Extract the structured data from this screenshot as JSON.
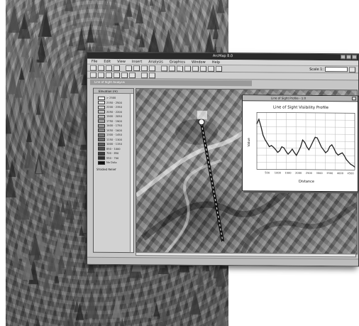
{
  "window": {
    "title": "ArcMap 8.0",
    "menu": [
      "File",
      "Edit",
      "View",
      "Insert",
      "Analysis",
      "Graphics",
      "Window",
      "Help"
    ],
    "scale_label": "Scale 1:",
    "document_title": "Line of Sight Analysis"
  },
  "legend": {
    "title": "Elevation (m)",
    "items": [
      {
        "label": "> 2500",
        "color": "#f4f4f4"
      },
      {
        "label": "2350 - 2500",
        "color": "#e6e6e6"
      },
      {
        "label": "2200 - 2350",
        "color": "#d6d6d6"
      },
      {
        "label": "2050 - 2200",
        "color": "#c6c6c6"
      },
      {
        "label": "1900 - 2050",
        "color": "#b8b8b8"
      },
      {
        "label": "1750 - 1900",
        "color": "#a8a8a8"
      },
      {
        "label": "1600 - 1750",
        "color": "#9a9a9a"
      },
      {
        "label": "1450 - 1600",
        "color": "#8a8a8a"
      },
      {
        "label": "1300 - 1450",
        "color": "#7c7c7c"
      },
      {
        "label": "1150 - 1300",
        "color": "#6c6c6c"
      },
      {
        "label": "1000 - 1150",
        "color": "#5e5e5e"
      },
      {
        "label": "850 - 1000",
        "color": "#4e4e4e"
      },
      {
        "label": "700 - 850",
        "color": "#404040"
      },
      {
        "label": "550 - 700",
        "color": "#303030"
      },
      {
        "label": "No Data",
        "color": "#101010"
      }
    ],
    "sub_layer": "Shaded Relief"
  },
  "profile": {
    "window_title": "Line of Sight Profile - 1:0",
    "x_tick_labels": [
      "500",
      "1000",
      "1500",
      "2000",
      "2500",
      "3000",
      "3500",
      "4000",
      "4500"
    ]
  },
  "chart_data": {
    "type": "line",
    "title": "Line of Sight Visibility Profile",
    "xlabel": "Distance",
    "ylabel": "Value",
    "x": [
      0,
      100,
      200,
      300,
      400,
      500,
      600,
      700,
      800,
      900,
      1000,
      1100,
      1200,
      1300,
      1400,
      1500,
      1600,
      1700,
      1800,
      1900,
      2000,
      2100,
      2200,
      2300,
      2400,
      2500,
      2600,
      2700,
      2800,
      2900,
      3000,
      3100,
      3200,
      3300,
      3400,
      3500,
      3600,
      3700,
      3800,
      3900,
      4000,
      4100,
      4200,
      4300,
      4400,
      4500,
      4600,
      4700
    ],
    "series": [
      {
        "values": [
          2100,
          2180,
          2050,
          1900,
          1820,
          1760,
          1700,
          1720,
          1690,
          1650,
          1600,
          1630,
          1700,
          1680,
          1620,
          1570,
          1610,
          1660,
          1600,
          1550,
          1620,
          1700,
          1820,
          1780,
          1700,
          1650,
          1720,
          1800,
          1870,
          1860,
          1780,
          1700,
          1650,
          1600,
          1630,
          1710,
          1740,
          1680,
          1600,
          1560,
          1580,
          1600,
          1550,
          1480,
          1440,
          1400,
          1380,
          1350
        ]
      }
    ],
    "xlim": [
      0,
      4700
    ],
    "ylim": [
      1300,
      2300
    ],
    "grid": true
  },
  "colors": {
    "accent": "#2a2a2a",
    "window_bg": "#c6c6c6",
    "profile_line": "#222222",
    "sight_line": "#111111"
  }
}
